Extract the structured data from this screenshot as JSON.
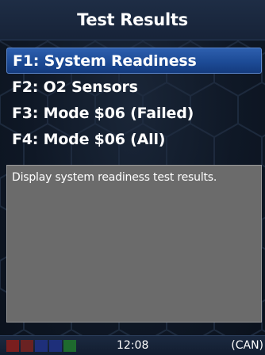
{
  "header": {
    "title": "Test Results"
  },
  "menu": {
    "items": [
      {
        "label": "F1: System Readiness",
        "selected": true
      },
      {
        "label": "F2: O2 Sensors",
        "selected": false
      },
      {
        "label": "F3: Mode $06 (Failed)",
        "selected": false
      },
      {
        "label": "F4: Mode $06 (All)",
        "selected": false
      }
    ]
  },
  "description": {
    "text": "Display system readiness test results."
  },
  "status_bar": {
    "time": "12:08",
    "protocol": "(CAN)",
    "indicators": [
      {
        "name": "indicator-1",
        "color": "#7a1e1e"
      },
      {
        "name": "indicator-2",
        "color": "#6a2222"
      },
      {
        "name": "indicator-3",
        "color": "#1e2f7a"
      },
      {
        "name": "indicator-4",
        "color": "#1e2f7a"
      },
      {
        "name": "indicator-5",
        "color": "#1e6a2e"
      }
    ]
  },
  "colors": {
    "selection": "#1d4b96",
    "description_bg": "#6b6b6b",
    "background": "#0f1826"
  }
}
